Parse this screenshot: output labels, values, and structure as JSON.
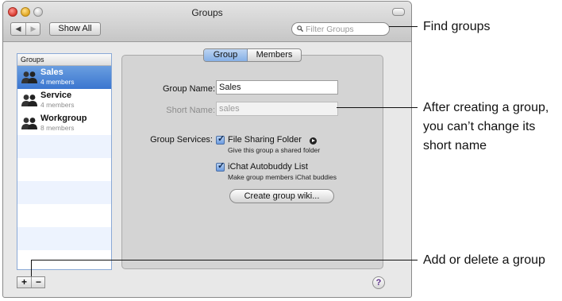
{
  "window": {
    "title": "Groups",
    "show_all_label": "Show All",
    "search_placeholder": "Filter Groups"
  },
  "sidebar": {
    "header": "Groups",
    "groups": [
      {
        "name": "Sales",
        "members": "4 members",
        "selected": true
      },
      {
        "name": "Service",
        "members": "4 members",
        "selected": false
      },
      {
        "name": "Workgroup",
        "members": "8 members",
        "selected": false
      }
    ]
  },
  "toolbar": {
    "add_label": "+",
    "remove_label": "−",
    "help_label": "?"
  },
  "tabs": [
    {
      "label": "Group",
      "active": true
    },
    {
      "label": "Members",
      "active": false
    }
  ],
  "form": {
    "group_name_label": "Group Name:",
    "group_name_value": "Sales",
    "short_name_label": "Short Name:",
    "short_name_value": "sales",
    "services_label": "Group Services:",
    "services": [
      {
        "title": "File Sharing Folder",
        "description": "Give this group a shared folder",
        "checked": true
      },
      {
        "title": "iChat Autobuddy List",
        "description": "Make group members iChat buddies",
        "checked": true
      }
    ],
    "wiki_button": "Create group wiki..."
  },
  "callouts": {
    "find": "Find groups",
    "short_name_line1": "After creating a group,",
    "short_name_line2": "you can’t change its",
    "short_name_line3": "short name",
    "add_delete": "Add or delete a group"
  }
}
